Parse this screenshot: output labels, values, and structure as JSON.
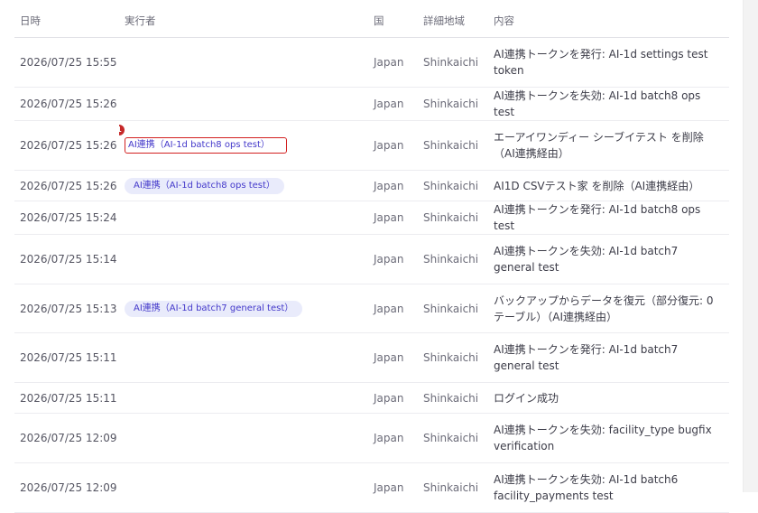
{
  "columns": {
    "datetime": "日時",
    "executor": "実行者",
    "country": "国",
    "region": "詳細地域",
    "content": "内容"
  },
  "marker": {
    "number": "1"
  },
  "rows": [
    {
      "datetime": "2026/07/25 15:55",
      "executor": "",
      "country": "Japan",
      "region": "Shinkaichi",
      "content": "AI連携トークンを発行: AI-1d settings test token"
    },
    {
      "datetime": "2026/07/25 15:26",
      "executor": "",
      "country": "Japan",
      "region": "Shinkaichi",
      "content": "AI連携トークンを失効: AI-1d batch8 ops test"
    },
    {
      "datetime": "2026/07/25 15:26",
      "executor": "AI連携（AI-1d batch8 ops test）",
      "country": "Japan",
      "region": "Shinkaichi",
      "content": "エーアイワンディー シーブイテスト を削除（AI連携経由）"
    },
    {
      "datetime": "2026/07/25 15:26",
      "executor": "AI連携（AI-1d batch8 ops test）",
      "country": "Japan",
      "region": "Shinkaichi",
      "content": "AI1D CSVテスト家 を削除（AI連携経由）"
    },
    {
      "datetime": "2026/07/25 15:24",
      "executor": "",
      "country": "Japan",
      "region": "Shinkaichi",
      "content": "AI連携トークンを発行: AI-1d batch8 ops test"
    },
    {
      "datetime": "2026/07/25 15:14",
      "executor": "",
      "country": "Japan",
      "region": "Shinkaichi",
      "content": "AI連携トークンを失効: AI-1d batch7 general test"
    },
    {
      "datetime": "2026/07/25 15:13",
      "executor": "AI連携（AI-1d batch7 general test）",
      "country": "Japan",
      "region": "Shinkaichi",
      "content": "バックアップからデータを復元（部分復元: 0テーブル）（AI連携経由）"
    },
    {
      "datetime": "2026/07/25 15:11",
      "executor": "",
      "country": "Japan",
      "region": "Shinkaichi",
      "content": "AI連携トークンを発行: AI-1d batch7 general test"
    },
    {
      "datetime": "2026/07/25 15:11",
      "executor": "",
      "country": "Japan",
      "region": "Shinkaichi",
      "content": "ログイン成功"
    },
    {
      "datetime": "2026/07/25 12:09",
      "executor": "",
      "country": "Japan",
      "region": "Shinkaichi",
      "content": "AI連携トークンを失効: facility_type bugfix verification"
    },
    {
      "datetime": "2026/07/25 12:09",
      "executor": "",
      "country": "Japan",
      "region": "Shinkaichi",
      "content": "AI連携トークンを失効: AI-1d batch6 facility_payments test"
    }
  ]
}
